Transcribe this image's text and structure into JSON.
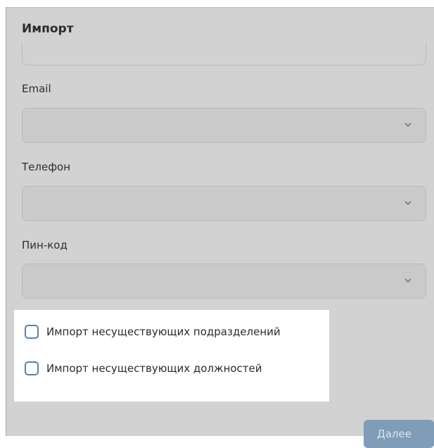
{
  "dialog": {
    "title": "Импорт"
  },
  "fields": [
    {
      "label": "Email",
      "value": "",
      "icon": "chevron-down-icon"
    },
    {
      "label": "Телефон",
      "value": "",
      "icon": "chevron-down-icon"
    },
    {
      "label": "Пин-код",
      "value": "",
      "icon": "chevron-down-icon"
    }
  ],
  "options": [
    {
      "label": "Импорт несуществующих подразделений",
      "checked": false
    },
    {
      "label": "Импорт несуществующих должностей",
      "checked": false
    }
  ],
  "actions": {
    "next_label": "Далее"
  },
  "colors": {
    "dialog_background": "#d2d2d2",
    "checkbox_border": "#5b7faa",
    "button_background": "#7f9cb8"
  }
}
